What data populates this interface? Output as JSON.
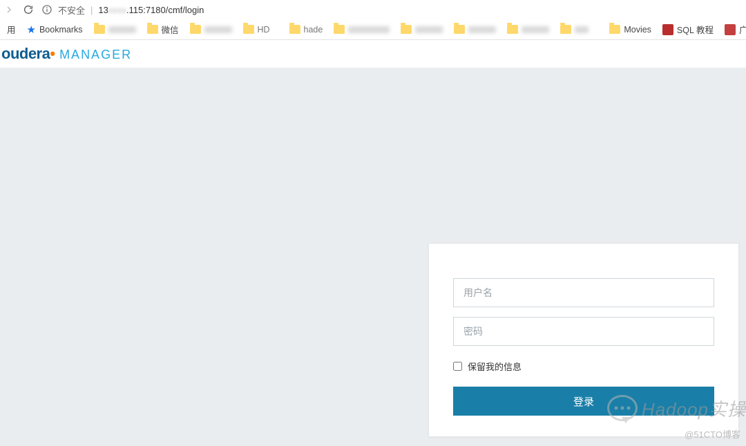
{
  "browser": {
    "security_label": "不安全",
    "url_visible_pre": "13",
    "url_visible_post": ".115:7180/cmf/login"
  },
  "bookmarks": {
    "first_char_label": "用",
    "bookmarks_label": "Bookmarks",
    "folder_labels": [
      "微信",
      "",
      "HD",
      "hade"
    ],
    "movies": "Movies",
    "sql": "SQL 教程",
    "gz": "广州市中"
  },
  "app": {
    "logo_part1": "oudera",
    "logo_part2": "MANAGER"
  },
  "login": {
    "username_placeholder": "用户名",
    "password_placeholder": "密码",
    "remember_label": "保留我的信息",
    "submit_label": "登录"
  },
  "watermark": {
    "main": "Hadoop实操",
    "small": "@51CTO博客"
  }
}
